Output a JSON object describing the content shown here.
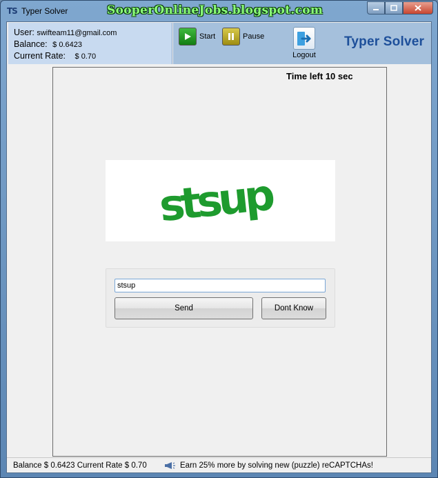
{
  "window": {
    "title": "Typer Solver",
    "icon_text": "TS",
    "watermark": "SooperOnlineJobs.blogspot.com",
    "controls": [
      "minimize-icon",
      "maximize-icon",
      "close-icon"
    ]
  },
  "user_info": {
    "user_label": "User:",
    "user_value": "swifteam11@gmail.com",
    "balance_label": "Balance:",
    "balance_value": "$ 0.6423",
    "rate_label": "Current Rate:",
    "rate_value": "$ 0.70"
  },
  "toolbar": {
    "start_label": "Start",
    "pause_label": "Pause",
    "logout_label": "Logout",
    "brand": "Typer Solver"
  },
  "captcha": {
    "time_left": "Time left 10 sec",
    "image_text": "stsup",
    "answer_value": "stsup",
    "send_label": "Send",
    "dont_know_label": "Dont Know",
    "captcha_color": "#1e9b2e"
  },
  "status": {
    "balance_text": "Balance $  0.6423  Current Rate $  0.70",
    "message": "Earn 25% more by solving new (puzzle) reCAPTCHAs!"
  }
}
